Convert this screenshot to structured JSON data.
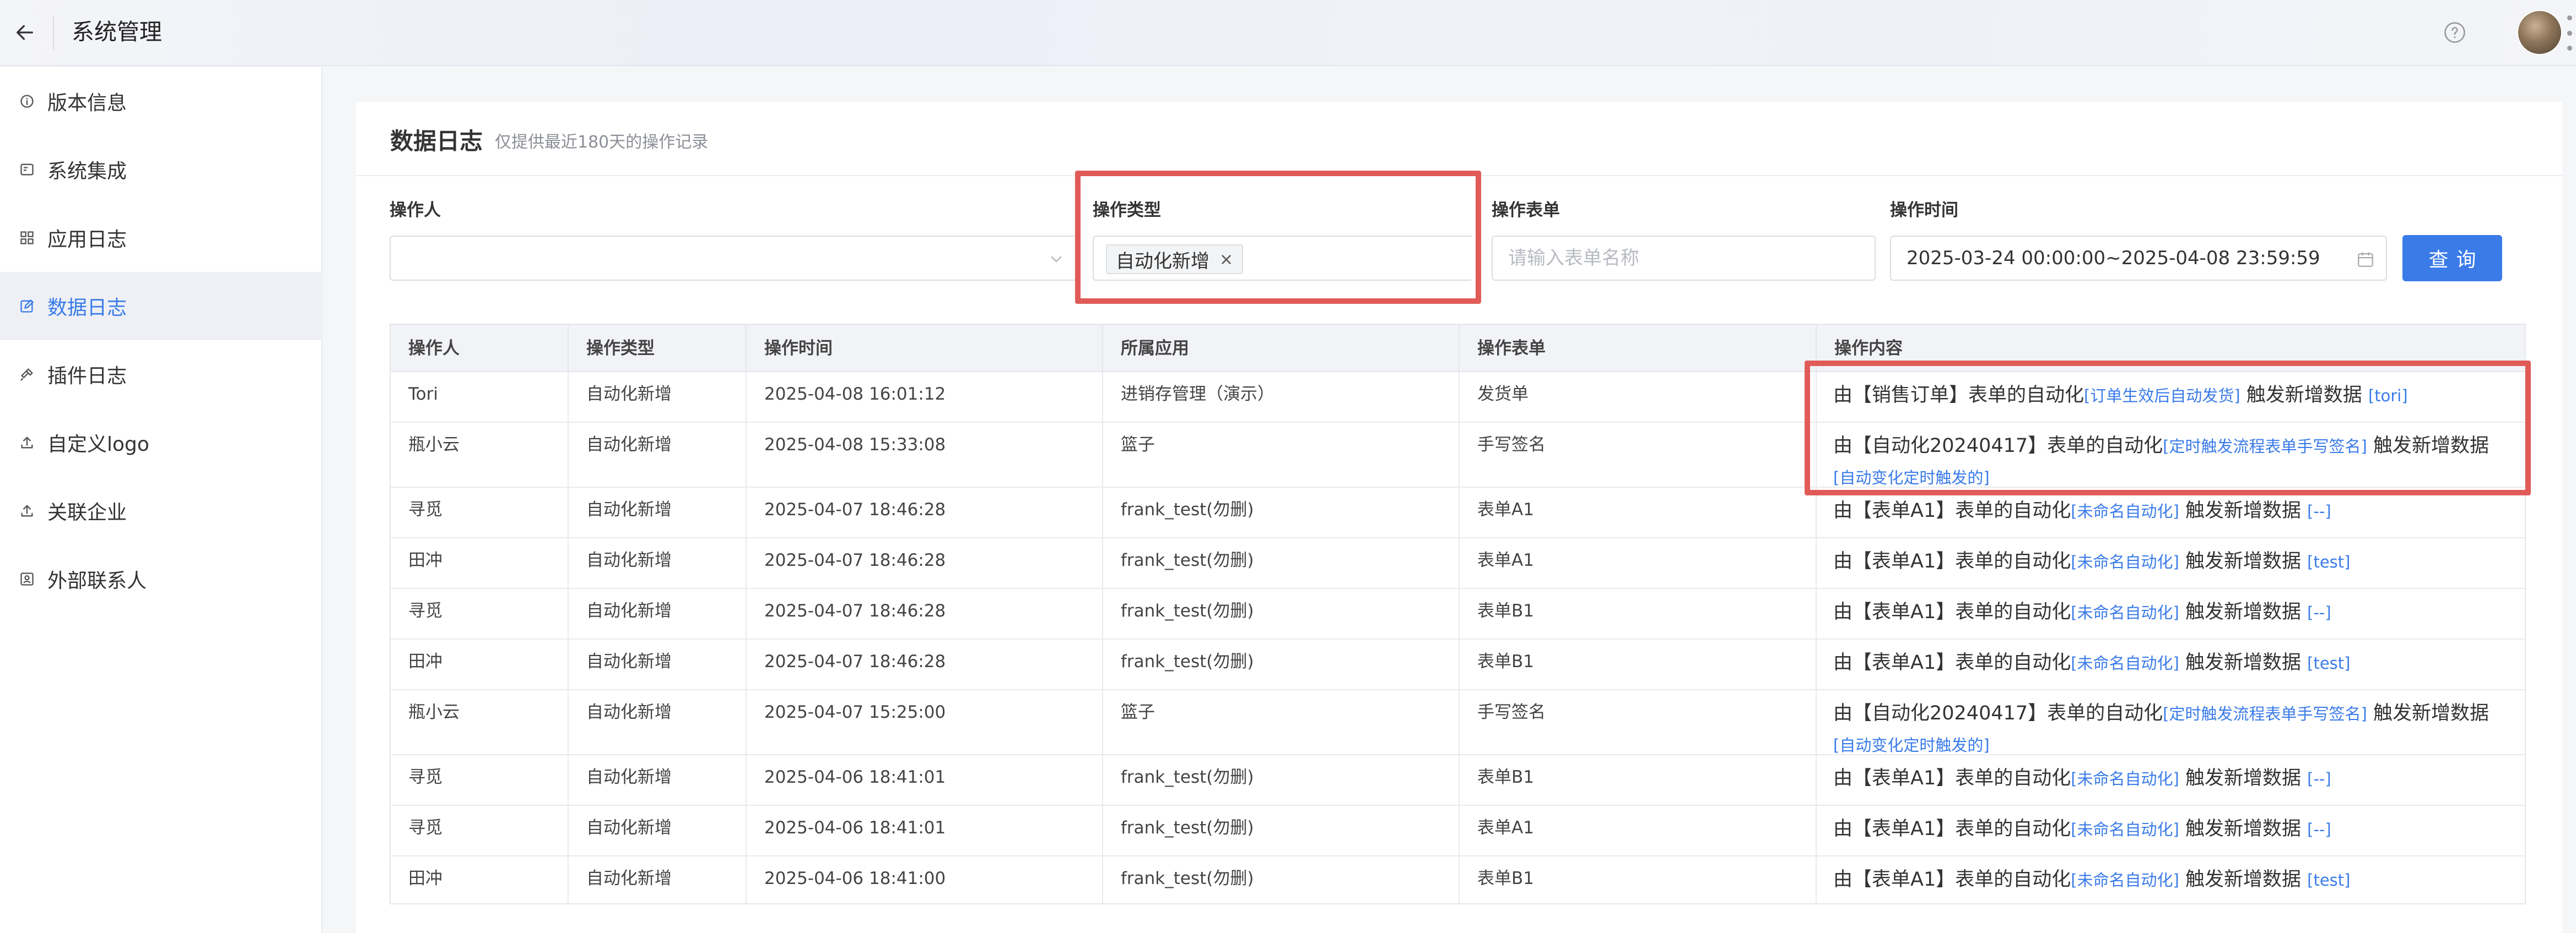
{
  "header": {
    "title": "系统管理"
  },
  "sidebar": {
    "items": [
      {
        "label": "版本信息",
        "icon": "info-icon",
        "active": false
      },
      {
        "label": "系统集成",
        "icon": "integration-icon",
        "active": false
      },
      {
        "label": "应用日志",
        "icon": "grid-icon",
        "active": false
      },
      {
        "label": "数据日志",
        "icon": "edit-log-icon",
        "active": true
      },
      {
        "label": "插件日志",
        "icon": "plugin-icon",
        "active": false
      },
      {
        "label": "自定义logo",
        "icon": "upload-icon",
        "active": false
      },
      {
        "label": "关联企业",
        "icon": "upload-icon",
        "active": false
      },
      {
        "label": "外部联系人",
        "icon": "contact-icon",
        "active": false
      }
    ]
  },
  "page": {
    "title": "数据日志",
    "subtitle": "仅提供最近180天的操作记录"
  },
  "filters": {
    "operator_label": "操作人",
    "type_label": "操作类型",
    "type_tag": "自动化新增",
    "form_label": "操作表单",
    "form_placeholder": "请输入表单名称",
    "time_label": "操作时间",
    "time_value": "2025-03-24 00:00:00~2025-04-08 23:59:59",
    "query_button": "查询"
  },
  "table": {
    "headers": [
      "操作人",
      "操作类型",
      "操作时间",
      "所属应用",
      "操作表单",
      "操作内容"
    ],
    "rows": [
      {
        "user": "Tori",
        "type": "自动化新增",
        "time": "2025-04-08 16:01:12",
        "app": "进销存管理（演示）",
        "form": "发货单",
        "c1": "由【销售订单】表单的自动化",
        "c2": "[订单生效后自动发货]",
        "c3": "触发新增数据",
        "c4": "[tori]"
      },
      {
        "user": "瓶小云",
        "type": "自动化新增",
        "time": "2025-04-08 15:33:08",
        "app": "篮子",
        "form": "手写签名",
        "c1": "由【自动化20240417】表单的自动化",
        "c2": "[定时触发流程表单手写签名]",
        "c3": "触发新增数据",
        "c4": "[自动变化定时触发的]"
      },
      {
        "user": "寻觅",
        "type": "自动化新增",
        "time": "2025-04-07 18:46:28",
        "app": "frank_test(勿删)",
        "form": "表单A1",
        "c1": "由【表单A1】表单的自动化",
        "c2": "[未命名自动化]",
        "c3": "触发新增数据",
        "c4": "[--]"
      },
      {
        "user": "田冲",
        "type": "自动化新增",
        "time": "2025-04-07 18:46:28",
        "app": "frank_test(勿删)",
        "form": "表单A1",
        "c1": "由【表单A1】表单的自动化",
        "c2": "[未命名自动化]",
        "c3": "触发新增数据",
        "c4": "[test]"
      },
      {
        "user": "寻觅",
        "type": "自动化新增",
        "time": "2025-04-07 18:46:28",
        "app": "frank_test(勿删)",
        "form": "表单B1",
        "c1": "由【表单A1】表单的自动化",
        "c2": "[未命名自动化]",
        "c3": "触发新增数据",
        "c4": "[--]"
      },
      {
        "user": "田冲",
        "type": "自动化新增",
        "time": "2025-04-07 18:46:28",
        "app": "frank_test(勿删)",
        "form": "表单B1",
        "c1": "由【表单A1】表单的自动化",
        "c2": "[未命名自动化]",
        "c3": "触发新增数据",
        "c4": "[test]"
      },
      {
        "user": "瓶小云",
        "type": "自动化新增",
        "time": "2025-04-07 15:25:00",
        "app": "篮子",
        "form": "手写签名",
        "c1": "由【自动化20240417】表单的自动化",
        "c2": "[定时触发流程表单手写签名]",
        "c3": "触发新增数据",
        "c4": "[自动变化定时触发的]"
      },
      {
        "user": "寻觅",
        "type": "自动化新增",
        "time": "2025-04-06 18:41:01",
        "app": "frank_test(勿删)",
        "form": "表单B1",
        "c1": "由【表单A1】表单的自动化",
        "c2": "[未命名自动化]",
        "c3": "触发新增数据",
        "c4": "[--]"
      },
      {
        "user": "寻觅",
        "type": "自动化新增",
        "time": "2025-04-06 18:41:01",
        "app": "frank_test(勿删)",
        "form": "表单A1",
        "c1": "由【表单A1】表单的自动化",
        "c2": "[未命名自动化]",
        "c3": "触发新增数据",
        "c4": "[--]"
      },
      {
        "user": "田冲",
        "type": "自动化新增",
        "time": "2025-04-06 18:41:00",
        "app": "frank_test(勿删)",
        "form": "表单B1",
        "c1": "由【表单A1】表单的自动化",
        "c2": "[未命名自动化]",
        "c3": "触发新增数据",
        "c4": "[test]"
      }
    ]
  },
  "colors": {
    "accent": "#3a7be8",
    "highlight": "#e05b58",
    "sidebar_active_bg": "#eef0f5"
  }
}
